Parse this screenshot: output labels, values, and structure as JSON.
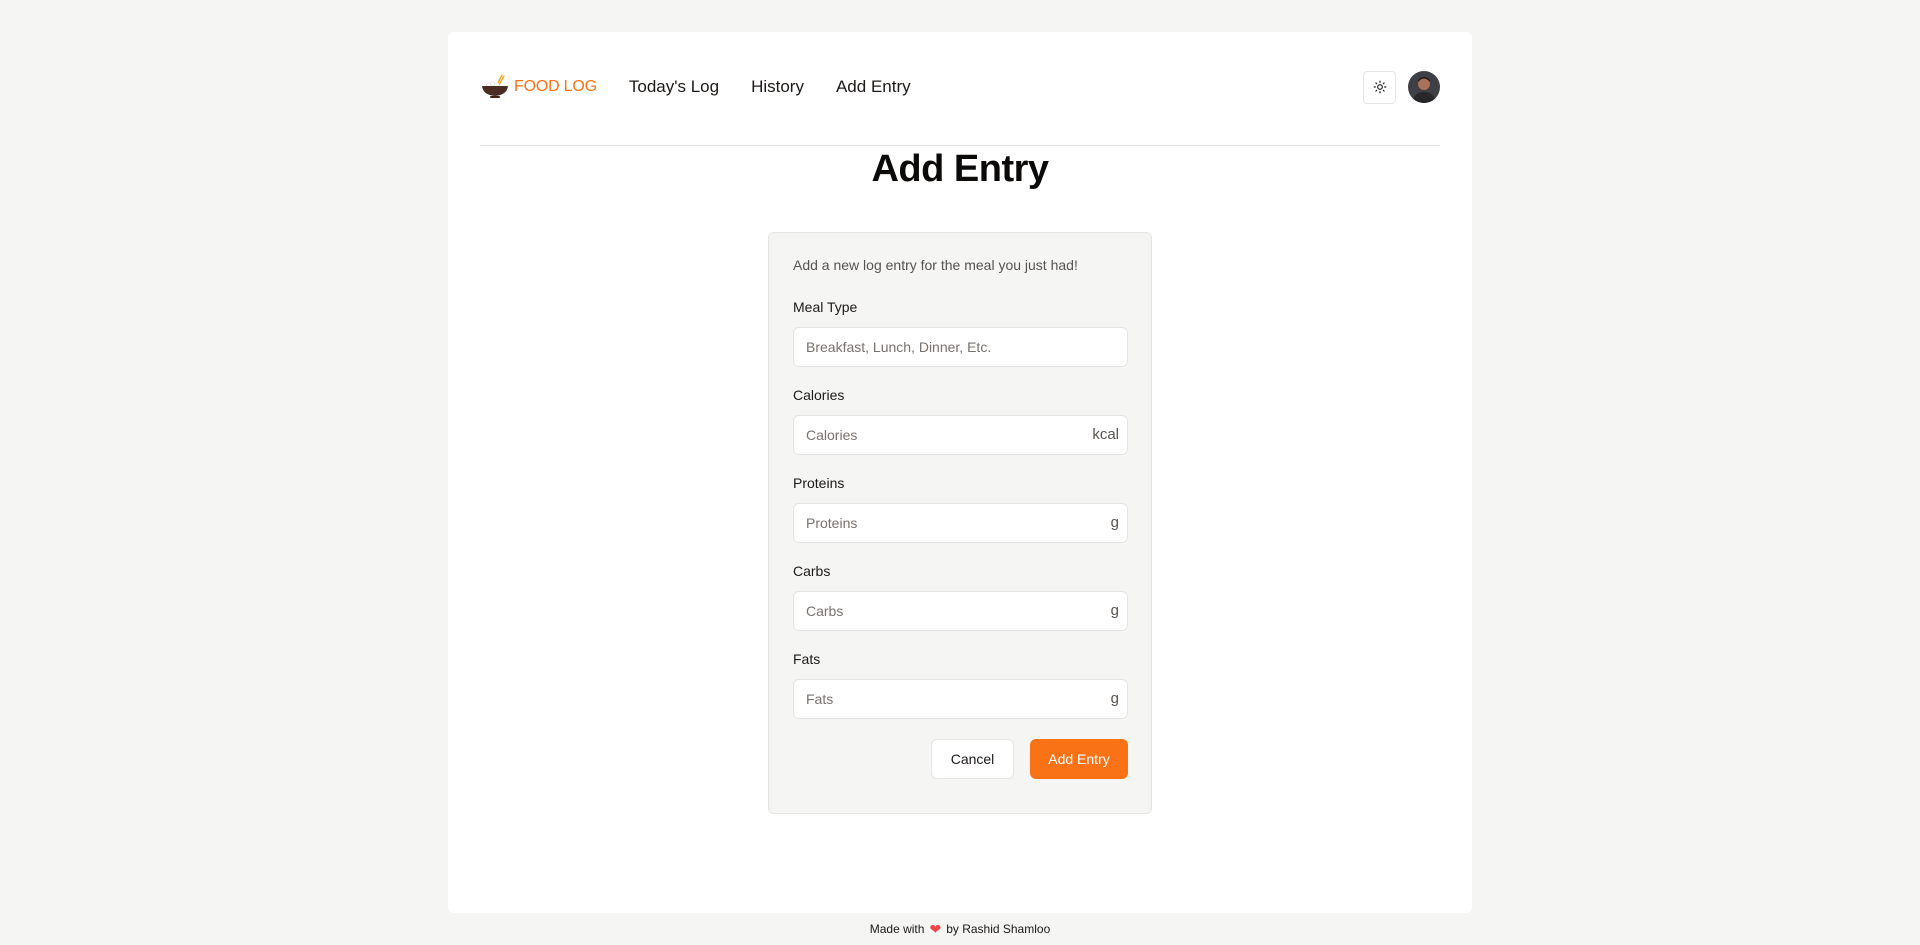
{
  "navbar": {
    "brand": "FOOD LOG",
    "links": [
      "Today's Log",
      "History",
      "Add Entry"
    ],
    "theme_toggle_icon": "sun-icon",
    "avatar_icon": "user-avatar"
  },
  "page": {
    "title": "Add Entry"
  },
  "form": {
    "description": "Add a new log entry for the meal you just had!",
    "fields": [
      {
        "label": "Meal Type",
        "placeholder": "Breakfast, Lunch, Dinner, Etc.",
        "value": "",
        "suffix": ""
      },
      {
        "label": "Calories",
        "placeholder": "Calories",
        "value": "",
        "suffix": "kcal"
      },
      {
        "label": "Proteins",
        "placeholder": "Proteins",
        "value": "",
        "suffix": "g"
      },
      {
        "label": "Carbs",
        "placeholder": "Carbs",
        "value": "",
        "suffix": "g"
      },
      {
        "label": "Fats",
        "placeholder": "Fats",
        "value": "",
        "suffix": "g"
      }
    ],
    "cancel_label": "Cancel",
    "submit_label": "Add Entry"
  },
  "footer": {
    "prefix": "Made with",
    "heart": "❤",
    "suffix": "by Rashid Shamloo"
  },
  "colors": {
    "accent": "#f97316",
    "background": "#f5f5f4",
    "heart": "#ef4444"
  }
}
